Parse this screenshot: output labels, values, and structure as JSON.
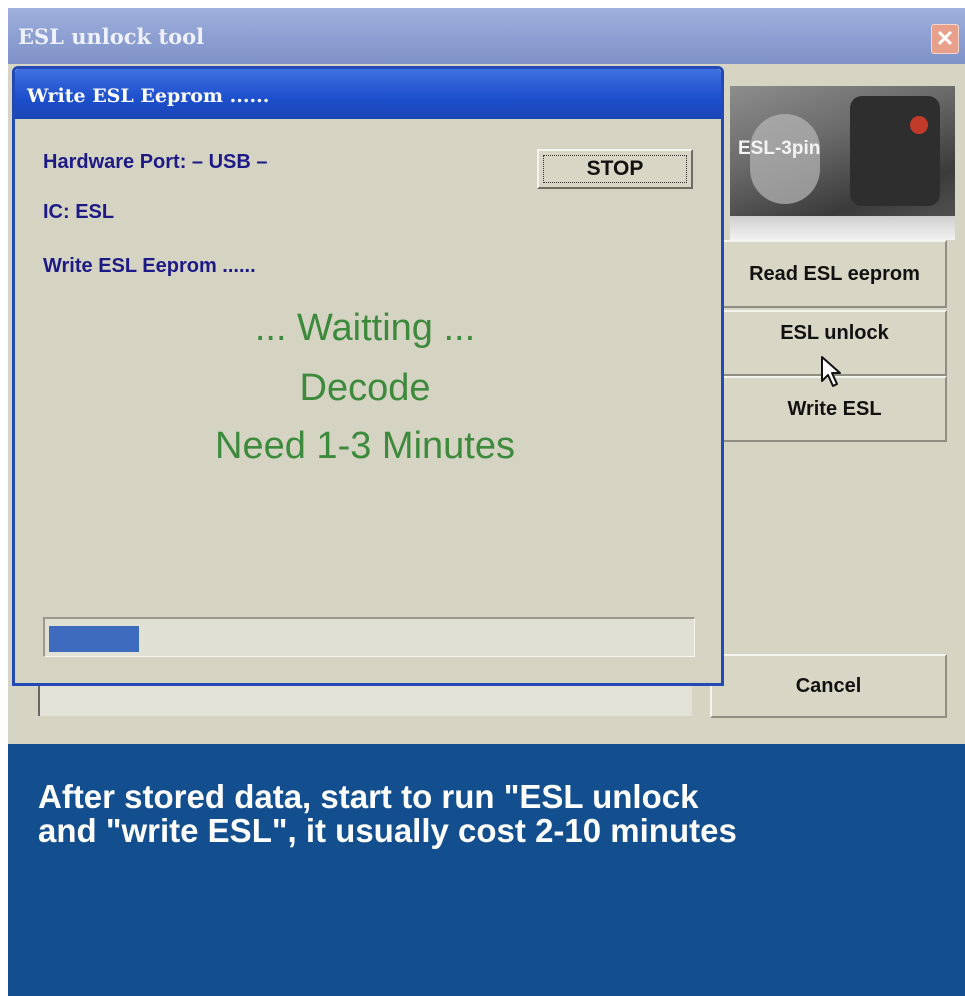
{
  "main_window": {
    "title": "ESL unlock tool",
    "close_glyph": "✕",
    "photo_label": "ESL-3pin",
    "buttons": {
      "read": "Read ESL eeprom",
      "unlock": "ESL unlock",
      "write": "Write ESL",
      "cancel": "Cancel"
    }
  },
  "dialog": {
    "title": "Write ESL Eeprom ......",
    "hardware_port": "Hardware Port: – USB –",
    "ic": "IC: ESL",
    "operation": "Write ESL Eeprom ......",
    "stop_label": "STOP",
    "status": {
      "line1": "... Waitting ...",
      "line2": "Decode",
      "line3": "Need 1-3 Minutes"
    },
    "progress_fraction": 0.14
  },
  "caption": {
    "line1": "After stored data, start to run \"ESL unlock",
    "line2": "and \"write ESL\", it usually cost 2-10 minutes"
  },
  "colors": {
    "dialog_title_bg": "#1d4fcc",
    "status_text": "#3d8a3d",
    "info_text": "#1d1a86",
    "caption_bg": "#134f8f",
    "progress_fill": "#3e6bbd"
  },
  "icons": {
    "close": "close-icon",
    "cursor": "mouse-pointer-icon"
  }
}
